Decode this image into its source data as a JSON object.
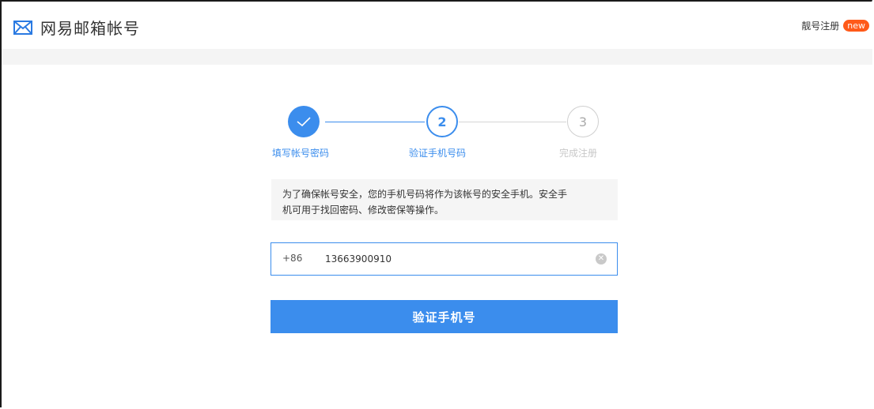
{
  "header": {
    "logo_icon": "mail-envelope-icon",
    "title": "网易邮箱帐号",
    "vip_register": "靓号注册",
    "new_badge": "new"
  },
  "steps": [
    {
      "number": "",
      "label": "填写帐号密码",
      "state": "done",
      "icon": "check-icon"
    },
    {
      "number": "2",
      "label": "验证手机号码",
      "state": "active"
    },
    {
      "number": "3",
      "label": "完成注册",
      "state": "pending"
    }
  ],
  "notice": {
    "line1": "为了确保帐号安全，您的手机号码将作为该帐号的安全手机。安全手",
    "line2": "机可用于找回密码、修改密保等操作。"
  },
  "phone": {
    "prefix": "+86",
    "value": "13663900910",
    "clear_icon": "clear-circle-icon"
  },
  "verify_button": "验证手机号",
  "colors": {
    "accent": "#3b8ded",
    "badge": "#ff5a19",
    "notice_bg": "#f5f5f5"
  }
}
